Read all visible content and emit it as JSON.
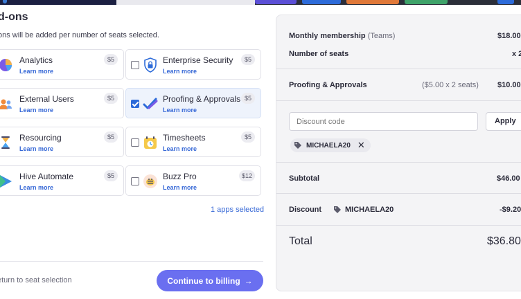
{
  "modal": {
    "title": "d-ons",
    "subtitle": "ons will be added per number of seats selected.",
    "learn_more": "Learn more",
    "apps_selected": "1 apps selected",
    "back_label": "eturn to seat selection",
    "continue_label": "Continue to billing",
    "continue_arrow": "→"
  },
  "addons": [
    {
      "name": "Analytics",
      "price": "$5",
      "checked": false,
      "icon": "pie-chart-icon"
    },
    {
      "name": "Enterprise Security",
      "price": "$5",
      "checked": false,
      "icon": "shield-lock-icon"
    },
    {
      "name": "External Users",
      "price": "$5",
      "checked": false,
      "icon": "users-icon"
    },
    {
      "name": "Proofing & Approvals",
      "price": "$5",
      "checked": true,
      "icon": "checkmarks-icon"
    },
    {
      "name": "Resourcing",
      "price": "$5",
      "checked": false,
      "icon": "hourglass-icon"
    },
    {
      "name": "Timesheets",
      "price": "$5",
      "checked": false,
      "icon": "calendar-clock-icon"
    },
    {
      "name": "Hive Automate",
      "price": "$5",
      "checked": false,
      "icon": "play-triangle-icon"
    },
    {
      "name": "Buzz Pro",
      "price": "$12",
      "checked": false,
      "icon": "bee-icon"
    }
  ],
  "summary": {
    "membership_label": "Monthly membership",
    "membership_plan": "(Teams)",
    "membership_value": "$18.00",
    "seats_label": "Number of seats",
    "seats_value": "x 2",
    "proofing_label": "Proofing & Approvals",
    "proofing_calc": "($5.00 x 2 seats)",
    "proofing_value": "$10.00",
    "discount_placeholder": "Discount code",
    "apply_label": "Apply",
    "coupon_code": "MICHAELA20",
    "subtotal_label": "Subtotal",
    "subtotal_value": "$46.00",
    "discount_label": "Discount",
    "discount_code": "MICHAELA20",
    "discount_value": "-$9.20",
    "total_label": "Total",
    "total_value": "$36.80"
  },
  "colors": {
    "accent": "#6a6ff0",
    "link": "#3567d6",
    "checkbox_on": "#2d6bd9"
  }
}
